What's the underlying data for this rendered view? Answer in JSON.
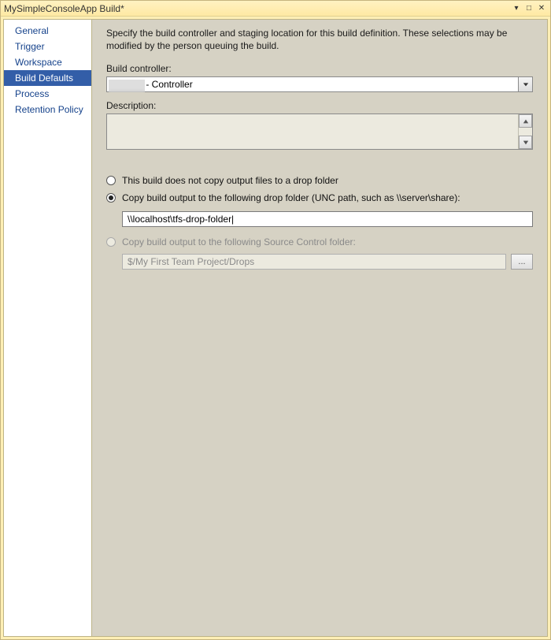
{
  "window": {
    "title": "MySimpleConsoleApp Build*"
  },
  "sidebar": {
    "items": [
      {
        "label": "General"
      },
      {
        "label": "Trigger"
      },
      {
        "label": "Workspace"
      },
      {
        "label": "Build Defaults",
        "selected": true
      },
      {
        "label": "Process"
      },
      {
        "label": "Retention Policy"
      }
    ]
  },
  "main": {
    "intro": "Specify the build controller and staging location for this build definition. These selections may be modified by the person queuing the build.",
    "controller_label": "Build controller:",
    "controller_value": "             - Controller",
    "description_label": "Description:",
    "description_value": "",
    "radio_no_copy": "This build does not copy output files to a drop folder",
    "radio_drop_folder": "Copy build output to the following drop folder (UNC path, such as \\\\server\\share):",
    "drop_folder_value": "\\\\localhost\\tfs-drop-folder|",
    "radio_source_control": "Copy build output to the following Source Control folder:",
    "source_control_value": "$/My First Team Project/Drops",
    "browse_label": "..."
  }
}
